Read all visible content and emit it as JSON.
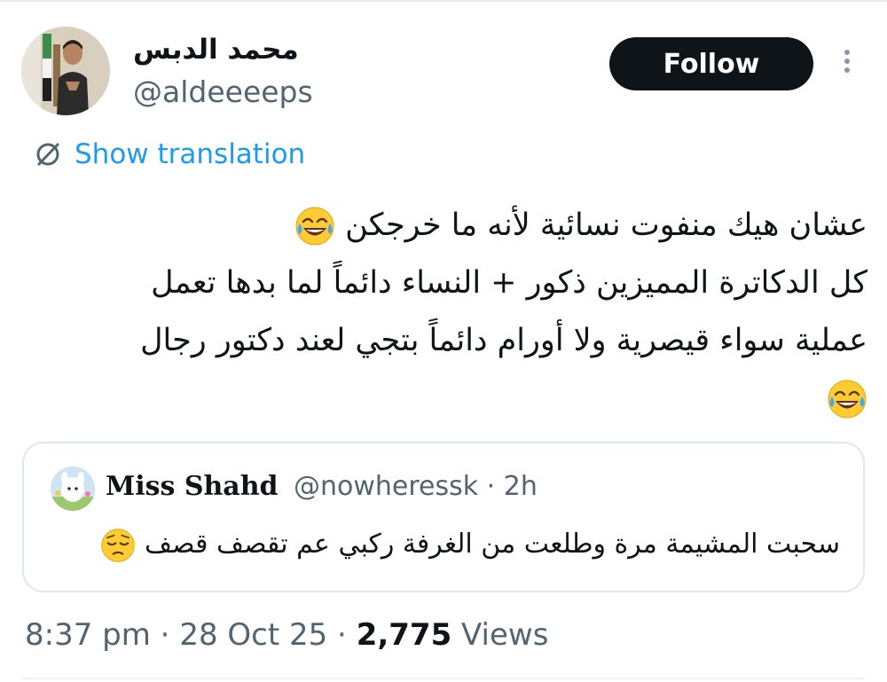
{
  "author": {
    "display_name": "محمد الدبس",
    "handle": "@aldeeeeps"
  },
  "follow_button": {
    "label": "Follow"
  },
  "more_menu": {
    "icon": "more-vertical-icon"
  },
  "translation": {
    "label": "Show translation",
    "icon": "globe-translate-icon"
  },
  "tweet": {
    "lines": [
      "عشان هيك منفوت نسائية لأنه ما خرجكن",
      "كل الدكاترة المميزين ذكور + النساء دائماً لما بدها تعمل",
      "عملية سواء قيصرية ولا أورام دائماً بتجي لعند دكتور رجال"
    ],
    "emoji": "face-with-tears-of-joy"
  },
  "quote": {
    "name": "Miss Shahd",
    "handle_time": "@nowheressk · 2h",
    "text": "سحبت المشيمة مرة وطلعت من الغرفة ركبي عم تقصف قصف",
    "emoji": "pensive-face"
  },
  "meta": {
    "time": "8:37 pm",
    "sep1": " · ",
    "date": "28 Oct 25",
    "sep2": " · ",
    "views": "2,775",
    "views_label": " Views"
  },
  "colors": {
    "text": "#0f1419",
    "secondary": "#536471",
    "link": "#1d9bf0",
    "border": "#e1e8ed",
    "button_bg": "#0f1419"
  }
}
